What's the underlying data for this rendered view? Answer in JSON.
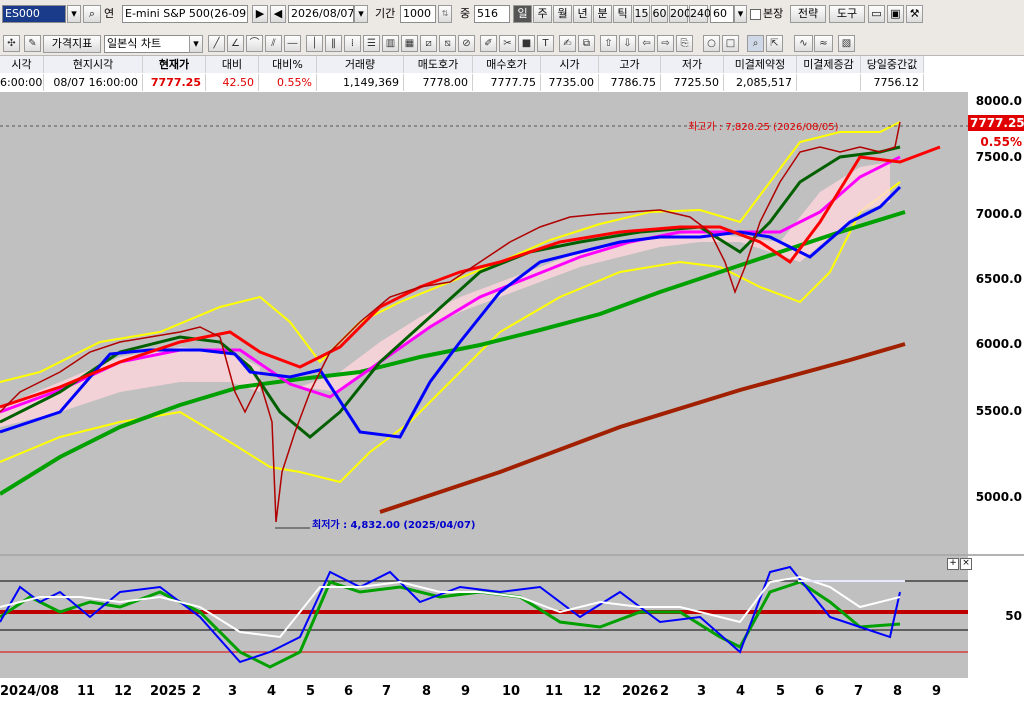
{
  "toolbar": {
    "code": "ES000",
    "sep": "연",
    "product": "E-mini S&P 500(26-09,",
    "date": "2026/08/07",
    "period_label": "기간",
    "period_value": "1000",
    "count_label": "중",
    "count_value": "516",
    "timeframes": [
      "일",
      "주",
      "월",
      "년",
      "분",
      "틱",
      "15",
      "60",
      "200",
      "240"
    ],
    "selected_timeframe": "일",
    "interval_value": "60",
    "overlap_label": "본장",
    "strategy_button": "전략",
    "tools_button": "도구",
    "indicator_button": "가격지표",
    "chart_type": "일본식 차트"
  },
  "quote": {
    "headers": [
      "시각",
      "현지시각",
      "현재가",
      "대비",
      "대비%",
      "거래량",
      "매도호가",
      "매수호가",
      "시가",
      "고가",
      "저가",
      "미결제약정",
      "미결제증감",
      "당일중간값"
    ],
    "values": [
      "6:00:00",
      "08/07 16:00:00",
      "7777.25",
      "42.50",
      "0.55%",
      "1,149,369",
      "7778.00",
      "7777.75",
      "7735.00",
      "7786.75",
      "7725.50",
      "2,085,517",
      "",
      "7756.12"
    ]
  },
  "chart": {
    "price_axis": [
      "8000.0",
      "7500.0",
      "7000.0",
      "6500.0",
      "6000.0",
      "5500.0",
      "5000.0"
    ],
    "current_price": "7777.25",
    "change_pct": "0.55%",
    "high_annotation": "최고가 : 7,820.25 (2026/08/05)",
    "low_annotation": "최저가 : 4,832.00 (2025/04/07)",
    "osc_label": "50",
    "x_labels": [
      "2024/08",
      "11",
      "12",
      "2025",
      "2",
      "3",
      "4",
      "5",
      "6",
      "7",
      "8",
      "9",
      "10",
      "11",
      "12",
      "2026",
      "2",
      "3",
      "4",
      "5",
      "6",
      "7",
      "8",
      "9"
    ],
    "colors": {
      "up": "#e00000",
      "down": "#0000d0",
      "bg": "#c0c0c0"
    }
  }
}
